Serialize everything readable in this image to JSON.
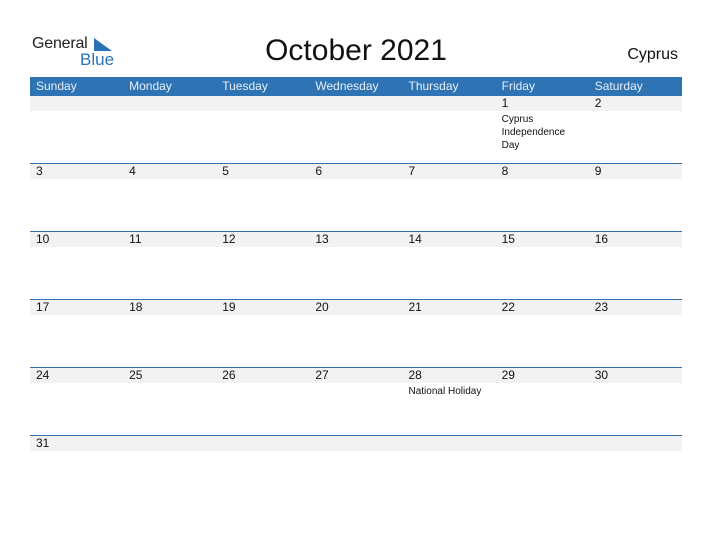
{
  "logo": {
    "general": "General",
    "blue": "Blue"
  },
  "title": "October 2021",
  "country": "Cyprus",
  "weekdays": [
    "Sunday",
    "Monday",
    "Tuesday",
    "Wednesday",
    "Thursday",
    "Friday",
    "Saturday"
  ],
  "weeks": [
    [
      {
        "d": ""
      },
      {
        "d": ""
      },
      {
        "d": ""
      },
      {
        "d": ""
      },
      {
        "d": ""
      },
      {
        "d": "1",
        "ev": "Cyprus Independence Day"
      },
      {
        "d": "2"
      }
    ],
    [
      {
        "d": "3"
      },
      {
        "d": "4"
      },
      {
        "d": "5"
      },
      {
        "d": "6"
      },
      {
        "d": "7"
      },
      {
        "d": "8"
      },
      {
        "d": "9"
      }
    ],
    [
      {
        "d": "10"
      },
      {
        "d": "11"
      },
      {
        "d": "12"
      },
      {
        "d": "13"
      },
      {
        "d": "14"
      },
      {
        "d": "15"
      },
      {
        "d": "16"
      }
    ],
    [
      {
        "d": "17"
      },
      {
        "d": "18"
      },
      {
        "d": "19"
      },
      {
        "d": "20"
      },
      {
        "d": "21"
      },
      {
        "d": "22"
      },
      {
        "d": "23"
      }
    ],
    [
      {
        "d": "24"
      },
      {
        "d": "25"
      },
      {
        "d": "26"
      },
      {
        "d": "27"
      },
      {
        "d": "28",
        "ev": "National Holiday"
      },
      {
        "d": "29"
      },
      {
        "d": "30"
      }
    ],
    [
      {
        "d": "31"
      },
      {
        "d": ""
      },
      {
        "d": ""
      },
      {
        "d": ""
      },
      {
        "d": ""
      },
      {
        "d": ""
      },
      {
        "d": ""
      }
    ]
  ],
  "colors": {
    "accent": "#2e74b5",
    "band": "#f2f2f2"
  }
}
